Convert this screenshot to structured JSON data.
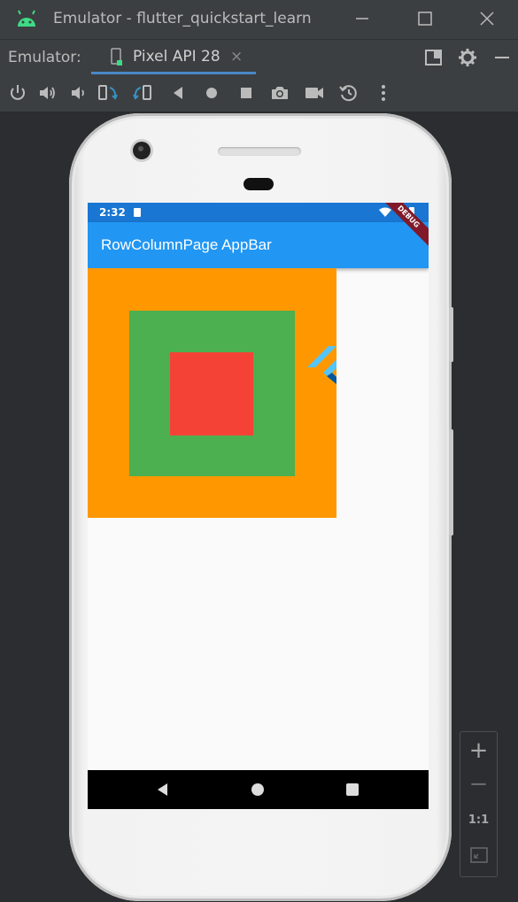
{
  "window": {
    "title": "Emulator - flutter_quickstart_learn",
    "icon": "android-icon",
    "controls": [
      "minimize-icon",
      "maximize-icon",
      "close-icon"
    ]
  },
  "tabbar": {
    "label": "Emulator:",
    "tab": {
      "label": "Pixel API 28",
      "close": "×",
      "icon": "device-icon"
    },
    "right_icons": [
      "layout-icon",
      "gear-icon",
      "minimize-panel-icon"
    ]
  },
  "toolbar": {
    "icons": [
      "power-icon",
      "volume-up-icon",
      "volume-down-icon",
      "rotate-left-icon",
      "rotate-right-icon",
      "back-icon",
      "home-icon",
      "overview-icon",
      "camera-icon",
      "video-icon",
      "snapshot-icon",
      "more-icon"
    ]
  },
  "device": {
    "status_bar": {
      "time": "2:32",
      "color": "#1976d2"
    },
    "app_bar": {
      "title": "RowColumnPage AppBar",
      "color": "#2196f3"
    },
    "debug_banner": "DEBUG",
    "boxes": {
      "outer": "#ff9800",
      "middle": "#4caf50",
      "inner": "#f44336"
    },
    "logo": "flutter-logo",
    "nav": [
      "nav-back-icon",
      "nav-home-icon",
      "nav-recents-icon"
    ]
  },
  "zoom": {
    "plus": "+",
    "minus": "−",
    "one_to_one": "1:1",
    "fit_icon": "fit-screen-icon"
  }
}
